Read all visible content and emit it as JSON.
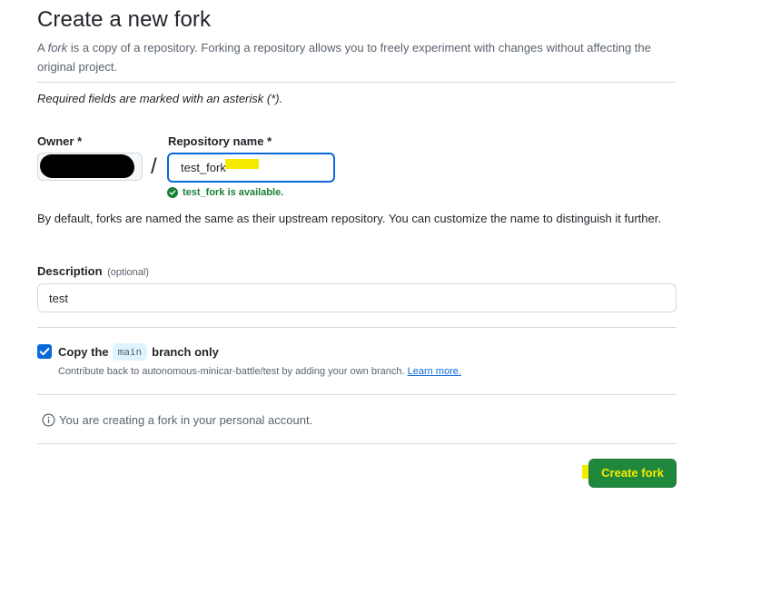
{
  "header": {
    "title": "Create a new fork",
    "intro_prefix": "A ",
    "intro_em": "fork",
    "intro_rest": " is a copy of a repository. Forking a repository allows you to freely experiment with changes without affecting the original project."
  },
  "form": {
    "required_note": "Required fields are marked with an asterisk (*).",
    "owner_label": "Owner *",
    "slash": "/",
    "repo_label": "Repository name *",
    "repo_value": "test_fork",
    "availability": "test_fork is available.",
    "naming_help": "By default, forks are named the same as their upstream repository. You can customize the name to distinguish it further.",
    "description_label": "Description",
    "description_optional": "(optional)",
    "description_value": "test",
    "copy_prefix": "Copy the",
    "copy_branch": "main",
    "copy_suffix": "branch only",
    "copy_checked": true,
    "copy_help": "Contribute back to autonomous-minicar-battle/test by adding your own branch.",
    "learn_more": "Learn more.",
    "account_note": "You are creating a fork in your personal account.",
    "create_button": "Create fork"
  },
  "colors": {
    "accent_blue": "#0969da",
    "success_green": "#1a7f37",
    "button_green": "#1f883d",
    "highlight_yellow": "#f4ea00"
  }
}
